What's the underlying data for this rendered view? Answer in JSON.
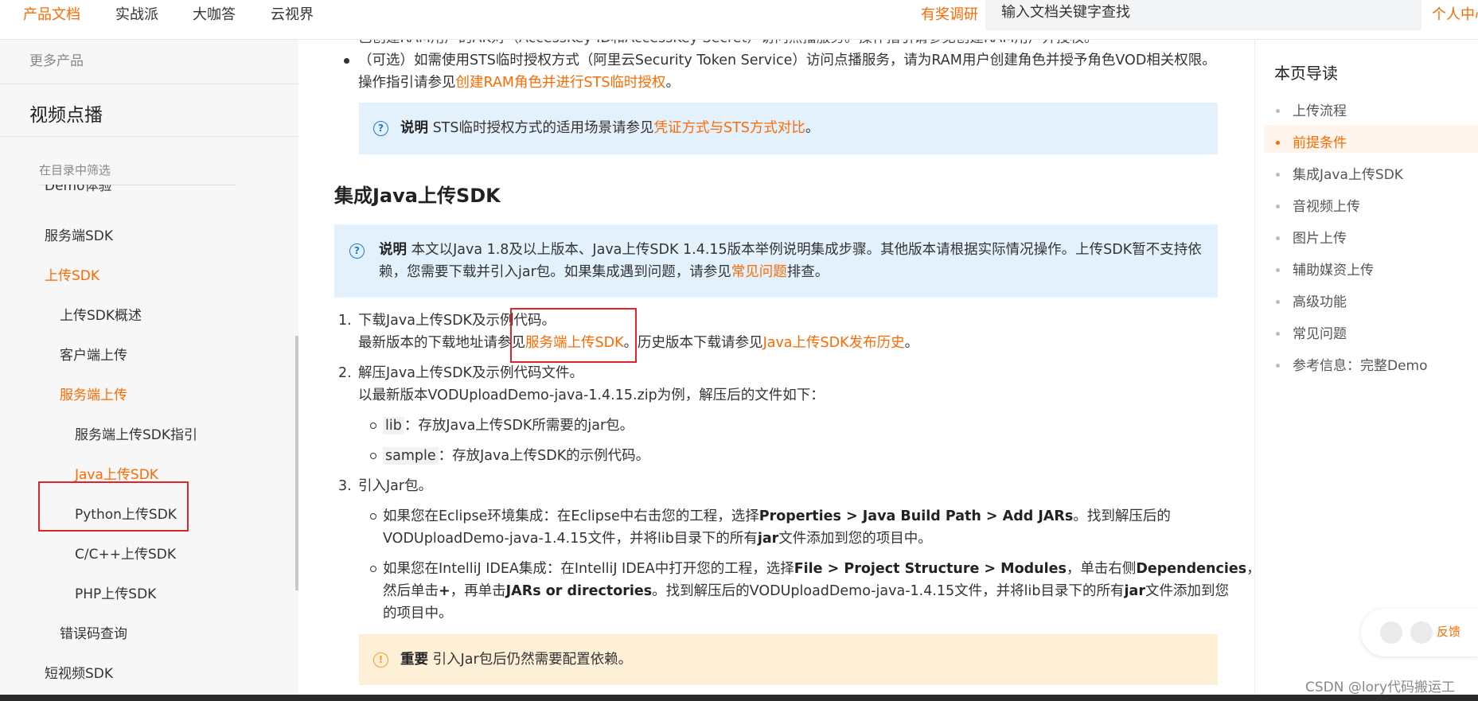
{
  "topnav": {
    "items": [
      "产品文档",
      "实战派",
      "大咖答",
      "云视界"
    ],
    "survey": "有奖调研",
    "search_placeholder": "输入文档关键字查找",
    "personal": "个人中心"
  },
  "sidebar": {
    "more_products": "更多产品",
    "title": "视频点播",
    "filter_placeholder": "在目录中筛选",
    "partial_item": "Demo体验",
    "items": [
      {
        "label": "服务端SDK",
        "active": false
      },
      {
        "label": "上传SDK",
        "active": true
      },
      {
        "label": "上传SDK概述",
        "active": false
      },
      {
        "label": "客户端上传",
        "active": false
      },
      {
        "label": "服务端上传",
        "active": true
      },
      {
        "label": "服务端上传SDK指引",
        "active": false
      },
      {
        "label": "Java上传SDK",
        "active": true
      },
      {
        "label": "Python上传SDK",
        "active": false
      },
      {
        "label": "C/C++上传SDK",
        "active": false
      },
      {
        "label": "PHP上传SDK",
        "active": false
      },
      {
        "label": "错误码查询",
        "active": false
      },
      {
        "label": "短视频SDK",
        "active": false
      }
    ]
  },
  "main": {
    "top_partial": "已创建RAM用户的AK对（AccessKey ID和AccessKey Secret）访问点播服务。操作指引请参见创建RAM用户并授权。",
    "optional_bullet": {
      "line1": "（可选）如需使用STS临时授权方式（阿里云Security Token Service）访问点播服务，请为RAM用户创建角色并授予角色VOD相关权限。",
      "line2_prefix": "操作指引请参见",
      "line2_link": "创建RAM角色并进行STS临时授权",
      "line2_suffix": "。"
    },
    "note1": {
      "label": "说明",
      "text": "STS临时授权方式的适用场景请参见",
      "link": "凭证方式与STS方式对比",
      "suffix": "。"
    },
    "heading": "集成Java上传SDK",
    "note2": {
      "label": "说明",
      "line1": "本文以Java 1.8及以上版本、Java上传SDK 1.4.15版本举例说明集成步骤。其他版本请根据实际情况操作。上传SDK暂不支持依",
      "line2_prefix": "赖，您需要下载并引入jar包。如果集成遇到问题，请参见",
      "line2_link": "常见问题",
      "line2_suffix": "排查。"
    },
    "step1": {
      "num": "1.",
      "title": "下载Java上传SDK及示例代码。",
      "line2_prefix": "最新版本的下载地址请参见",
      "link1": "服务端上传SDK",
      "middle": "。历史版本下载请参见",
      "link2": "Java上传SDK发布历史",
      "suffix": "。"
    },
    "step2": {
      "num": "2.",
      "title": "解压Java上传SDK及示例代码文件。",
      "line2": "以最新版本VODUploadDemo-java-1.4.15.zip为例，解压后的文件如下：",
      "items": [
        {
          "code": "lib",
          "text": "：存放Java上传SDK所需要的jar包。"
        },
        {
          "code": "sample",
          "text": "：存放Java上传SDK的示例代码。"
        }
      ]
    },
    "step3": {
      "num": "3.",
      "title": "引入Jar包。",
      "eclipse": {
        "p1": "如果您在Eclipse环境集成：在Eclipse中右击您的工程，选择",
        "b1": "Properties > Java Build Path > Add JARs",
        "p2": "。找到解压后的",
        "line2_p1": "VODUploadDemo-java-1.4.15文件，并将lib目录下的所有",
        "line2_b": "jar",
        "line2_p2": "文件添加到您的项目中。"
      },
      "idea": {
        "p1": "如果您在IntelliJ IDEA集成：在IntelliJ IDEA中打开您的工程，选择",
        "b1": "File > Project Structure > Modules",
        "p2": "，单击右侧",
        "b2": "Dependencies",
        "p3": "，",
        "line2_p1": "然后单击",
        "line2_b1": "+",
        "line2_p2": "，再单击",
        "line2_b2": "JARs or directories",
        "line2_p3": "。找到解压后的VODUploadDemo-java-1.4.15文件，并将lib目录下的所有",
        "line2_b3": "jar",
        "line2_p4": "文件添加到您",
        "line3": "的项目中。"
      }
    },
    "warning": {
      "label": "重要",
      "text": "引入Jar包后仍然需要配置依赖。"
    }
  },
  "toc": {
    "title": "本页导读",
    "items": [
      {
        "label": "上传流程",
        "active": false
      },
      {
        "label": "前提条件",
        "active": true
      },
      {
        "label": "集成Java上传SDK",
        "active": false
      },
      {
        "label": "音视频上传",
        "active": false
      },
      {
        "label": "图片上传",
        "active": false
      },
      {
        "label": "辅助媒资上传",
        "active": false
      },
      {
        "label": "高级功能",
        "active": false
      },
      {
        "label": "常见问题",
        "active": false
      },
      {
        "label": "参考信息：完整Demo",
        "active": false
      }
    ]
  },
  "feedback": {
    "label": "反馈"
  },
  "watermark": "CSDN @lory代码搬运工",
  "colors": {
    "accent": "#ff6a00",
    "note_bg": "#e3f1fd",
    "warn_bg": "#fdf0d6",
    "annotation_red": "#e0242a"
  }
}
